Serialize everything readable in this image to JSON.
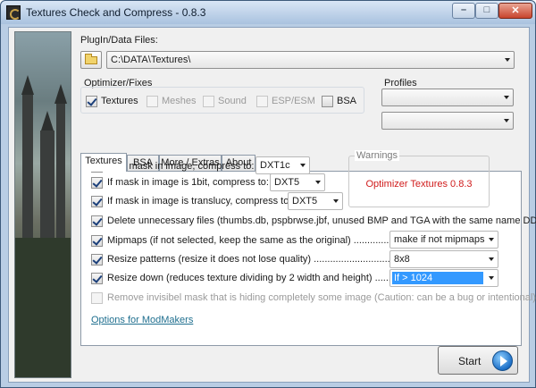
{
  "window": {
    "title": "Textures Check and Compress - 0.8.3"
  },
  "plugin": {
    "label": "PlugIn/Data Files:",
    "path": "C:\\DATA\\Textures\\"
  },
  "optimizer": {
    "label": "Optimizer/Fixes",
    "items": [
      {
        "label": "Textures",
        "checked": true,
        "enabled": true
      },
      {
        "label": "Meshes",
        "checked": false,
        "enabled": false
      },
      {
        "label": "Sound",
        "checked": false,
        "enabled": false
      },
      {
        "label": "ESP/ESM",
        "checked": false,
        "enabled": false
      },
      {
        "label": "BSA",
        "checked": false,
        "enabled": true
      }
    ]
  },
  "profiles": {
    "label": "Profiles",
    "combo1": "",
    "combo2": ""
  },
  "tabs": [
    "Textures",
    "BSA",
    "More / Extras",
    "About"
  ],
  "warnings": {
    "title": "Warnings",
    "message": "Optimizer Textures 0.8.3"
  },
  "options": [
    {
      "label": "If no mask in image, compress to:",
      "checked": true,
      "value": "DXT1c"
    },
    {
      "label": "If mask in image is 1bit, compress to:",
      "checked": true,
      "value": "DXT5"
    },
    {
      "label": "If mask in image is translucy, compress to:",
      "checked": true,
      "value": "DXT5"
    },
    {
      "label": "Delete unnecessary files (thumbs.db, pspbrwse.jbf, unused BMP and TGA with the same name DDS).",
      "checked": true
    },
    {
      "label": "Mipmaps (if not selected, keep the same as the original) ...........................",
      "checked": true,
      "value": "make if not mipmaps"
    },
    {
      "label": "Resize patterns (resize it does not lose quality) ..........................................",
      "checked": true,
      "value": "8x8"
    },
    {
      "label": "Resize down (reduces texture dividing by 2 width and height) ...................",
      "checked": true,
      "value": "If > 1024"
    },
    {
      "label": "Remove invisibel mask that is hiding completely some image (Caution: can be a bug or intentional)",
      "checked": false
    }
  ],
  "modmakers_link": "Options for ModMakers",
  "start_button": "Start"
}
